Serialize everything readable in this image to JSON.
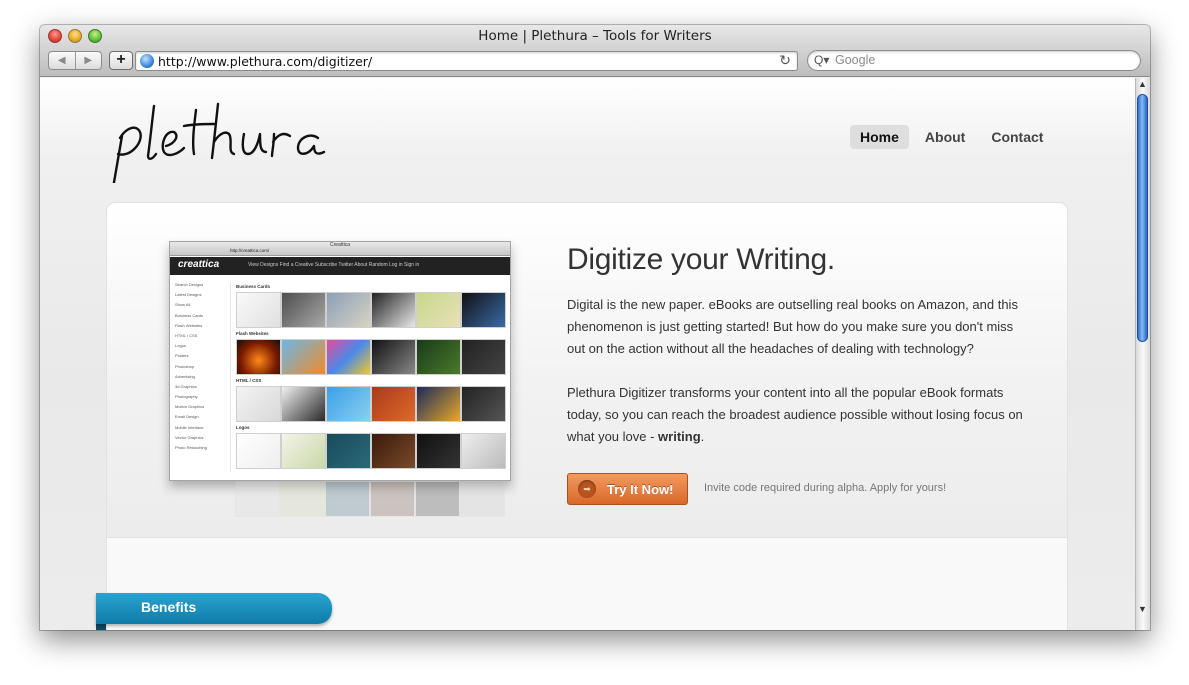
{
  "window": {
    "title": "Home | Plethura – Tools for Writers"
  },
  "toolbar": {
    "back_icon": "◀",
    "forward_icon": "▶",
    "add_icon": "+",
    "url": "http://www.plethura.com/digitizer/",
    "reload_icon": "↻",
    "search_placeholder": "Google",
    "search_icon": "Q▾"
  },
  "site": {
    "logo_text": "plethura",
    "nav": [
      {
        "label": "Home",
        "active": true
      },
      {
        "label": "About",
        "active": false
      },
      {
        "label": "Contact",
        "active": false
      }
    ]
  },
  "hero": {
    "headline": "Digitize your Writing.",
    "paragraph1": "Digital is the new paper. eBooks are outselling real books on Amazon, and this phenomenon is just getting started! But how do you make sure you don't miss out on the action without all the headaches of dealing with technology?",
    "paragraph2_start": "Plethura Digitizer transforms your content into all the popular eBook formats today, so you can reach the broadest audience possible without losing focus on what you love - ",
    "paragraph2_bold": "writing",
    "paragraph2_end": ".",
    "cta_label": "Try It Now!",
    "cta_icon": "➡",
    "invite_note": "Invite code required during alpha. Apply for yours!"
  },
  "screenshot": {
    "window_title": "Creattica",
    "url": "http://creattica.com/",
    "logo": "creattica",
    "nav": "View Designs      Find a Creative      Subscribe   Twitter   About   Random                            Log in    Sign in",
    "sidebar": [
      "Search Designs",
      "Latest Designs",
      "Show All",
      "Business Cards",
      "Flash Websites",
      "HTML / CSS",
      "Logos",
      "Posters",
      "Photoshop",
      "Advertising",
      "3d Graphics",
      "Photography",
      "Motion Graphics",
      "Email Design",
      "Mobile Interface",
      "Vector Graphics",
      "Photo Retouching"
    ],
    "sections": [
      "Business Cards",
      "Flash Websites",
      "HTML / CSS",
      "Logos"
    ]
  },
  "benefits": {
    "label": "Benefits"
  },
  "colors": {
    "accent_orange": "#e07a3c",
    "benefits_blue": "#1a92bf",
    "scroll_blue": "#3a7fd6"
  }
}
